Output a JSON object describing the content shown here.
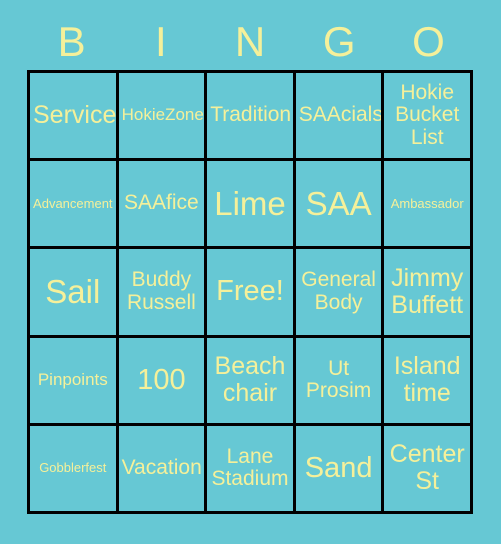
{
  "card": {
    "header_letters": [
      "B",
      "I",
      "N",
      "G",
      "O"
    ],
    "colors": {
      "background": "#66c8d4",
      "text": "#f5f09a",
      "border": "#000000"
    },
    "rows": [
      [
        {
          "label": "Service",
          "size": "lg"
        },
        {
          "label": "HokieZone",
          "size": "sm"
        },
        {
          "label": "Tradition",
          "size": "md"
        },
        {
          "label": "SAAcials",
          "size": "md"
        },
        {
          "label": "Hokie Bucket List",
          "size": "md"
        }
      ],
      [
        {
          "label": "Advancement",
          "size": "xs"
        },
        {
          "label": "SAAfice",
          "size": "md"
        },
        {
          "label": "Lime",
          "size": "xxl"
        },
        {
          "label": "SAA",
          "size": "xxl"
        },
        {
          "label": "Ambassador",
          "size": "xs"
        }
      ],
      [
        {
          "label": "Sail",
          "size": "xxl"
        },
        {
          "label": "Buddy Russell",
          "size": "md"
        },
        {
          "label": "Free!",
          "size": "xl"
        },
        {
          "label": "General Body",
          "size": "md"
        },
        {
          "label": "Jimmy Buffett",
          "size": "lg"
        }
      ],
      [
        {
          "label": "Pinpoints",
          "size": "sm"
        },
        {
          "label": "100",
          "size": "xl"
        },
        {
          "label": "Beach chair",
          "size": "lg"
        },
        {
          "label": "Ut Prosim",
          "size": "md"
        },
        {
          "label": "Island time",
          "size": "lg"
        }
      ],
      [
        {
          "label": "Gobblerfest",
          "size": "xs"
        },
        {
          "label": "Vacation",
          "size": "md"
        },
        {
          "label": "Lane Stadium",
          "size": "md"
        },
        {
          "label": "Sand",
          "size": "xl"
        },
        {
          "label": "Center St",
          "size": "lg"
        }
      ]
    ]
  }
}
